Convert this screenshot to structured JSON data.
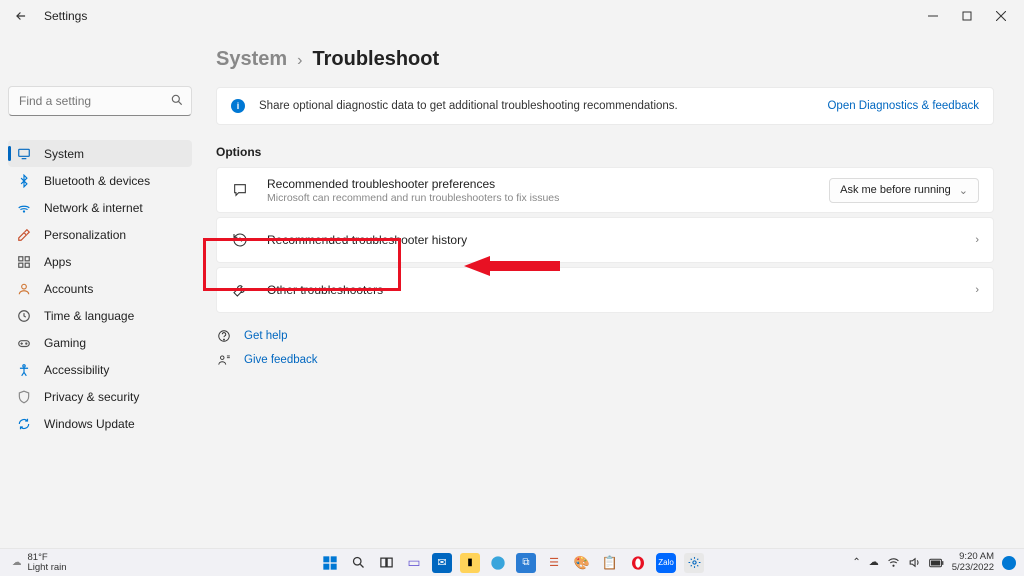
{
  "window": {
    "title": "Settings"
  },
  "search": {
    "placeholder": "Find a setting"
  },
  "nav": {
    "items": [
      {
        "label": "System"
      },
      {
        "label": "Bluetooth & devices"
      },
      {
        "label": "Network & internet"
      },
      {
        "label": "Personalization"
      },
      {
        "label": "Apps"
      },
      {
        "label": "Accounts"
      },
      {
        "label": "Time & language"
      },
      {
        "label": "Gaming"
      },
      {
        "label": "Accessibility"
      },
      {
        "label": "Privacy & security"
      },
      {
        "label": "Windows Update"
      }
    ]
  },
  "breadcrumb": {
    "parent": "System",
    "sep": "›",
    "current": "Troubleshoot"
  },
  "banner": {
    "text": "Share optional diagnostic data to get additional troubleshooting recommendations.",
    "link": "Open Diagnostics & feedback"
  },
  "sections": {
    "options": "Options"
  },
  "cards": {
    "pref": {
      "title": "Recommended troubleshooter preferences",
      "subtitle": "Microsoft can recommend and run troubleshooters to fix issues",
      "dropdown": "Ask me before running"
    },
    "history": {
      "title": "Recommended troubleshooter history"
    },
    "other": {
      "title": "Other troubleshooters"
    }
  },
  "links": {
    "help": "Get help",
    "feedback": "Give feedback"
  },
  "taskbar": {
    "weather_temp": "81°F",
    "weather_cond": "Light rain",
    "time": "9:20 AM",
    "date": "5/23/2022"
  }
}
